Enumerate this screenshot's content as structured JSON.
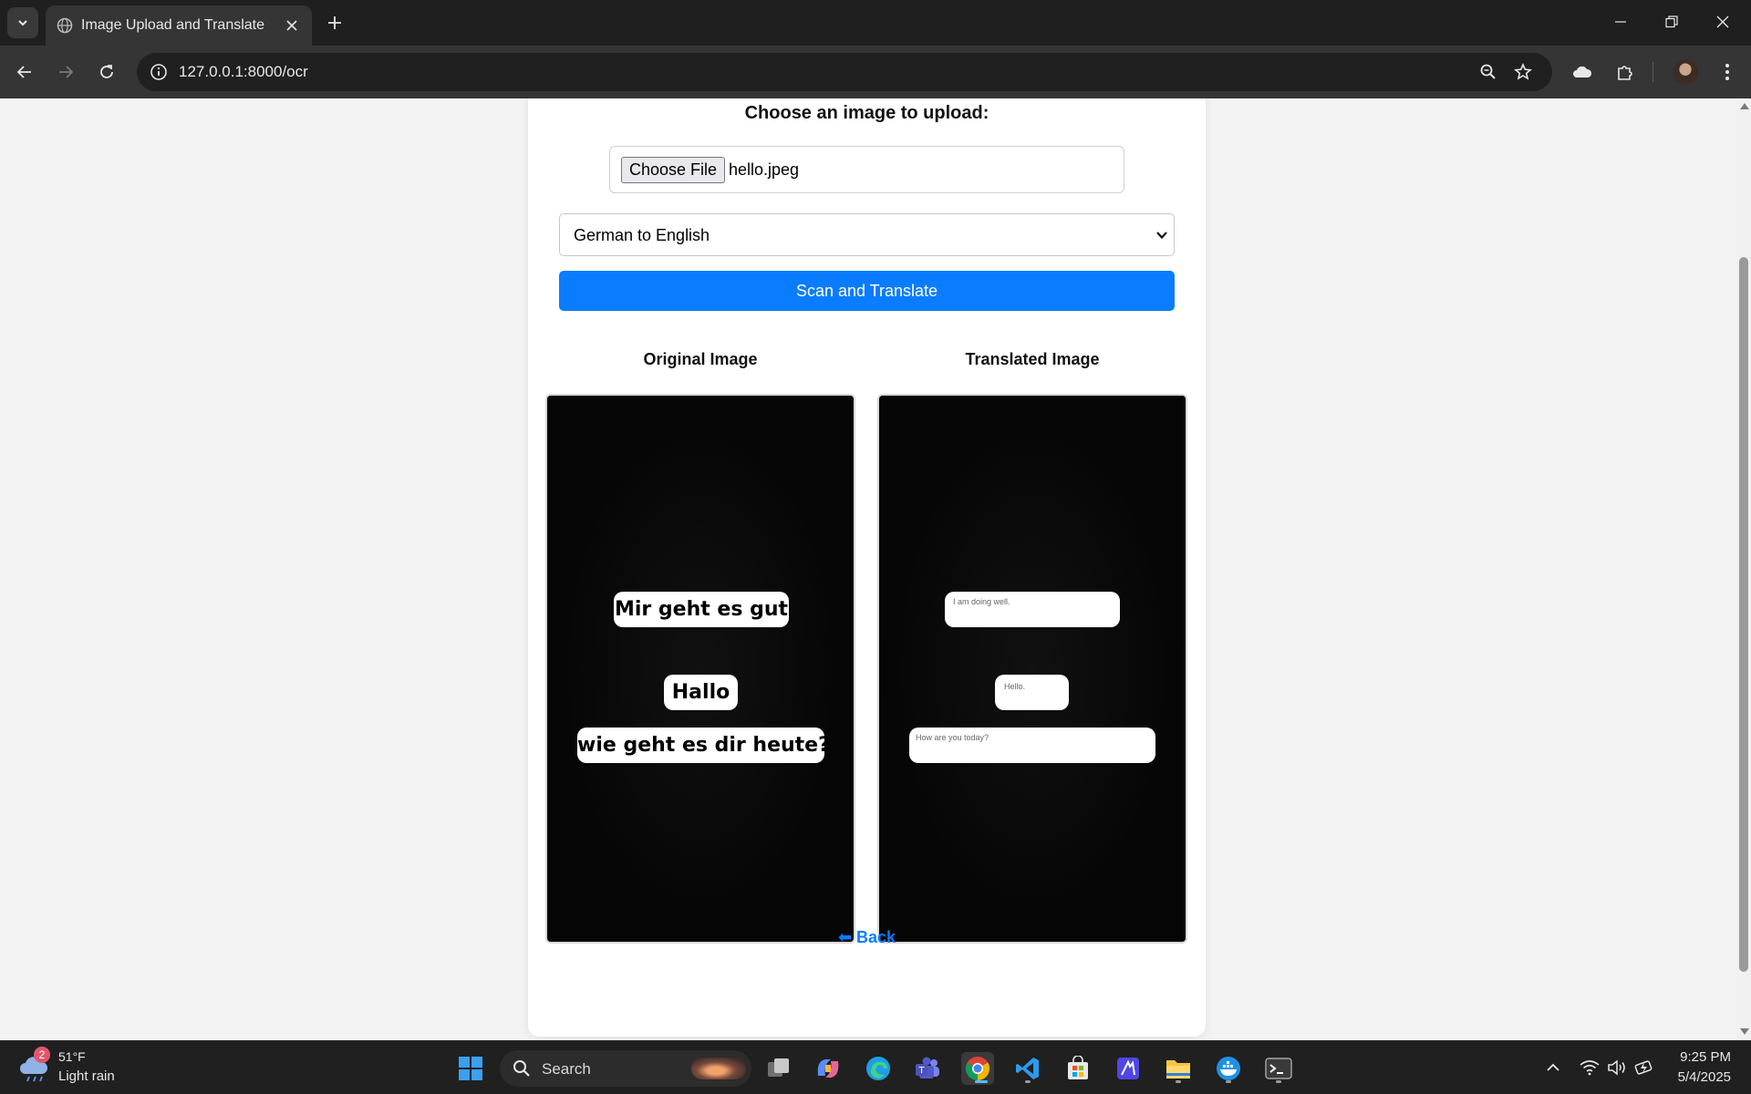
{
  "browser": {
    "tab_title": "Image Upload and Translate",
    "url": "127.0.0.1:8000/ocr"
  },
  "page": {
    "upload_label": "Choose an image to upload:",
    "file_button": "Choose File",
    "file_name": "hello.jpeg",
    "language_selected": "German to English",
    "scan_button": "Scan and Translate",
    "original_label": "Original Image",
    "translated_label": "Translated Image",
    "back_link": "Back",
    "accent_color": "#0a7cff"
  },
  "original_image": {
    "bubbles": [
      "Mir geht es gut",
      "Hallo",
      "wie geht es dir heute?"
    ]
  },
  "translated_image": {
    "bubbles": [
      "I am doing well.",
      "Hello.",
      "How are you today?"
    ]
  },
  "taskbar": {
    "weather_badge": "2",
    "weather_temp": "51°F",
    "weather_desc": "Light rain",
    "search_placeholder": "Search",
    "time": "9:25 PM",
    "date": "5/4/2025"
  }
}
